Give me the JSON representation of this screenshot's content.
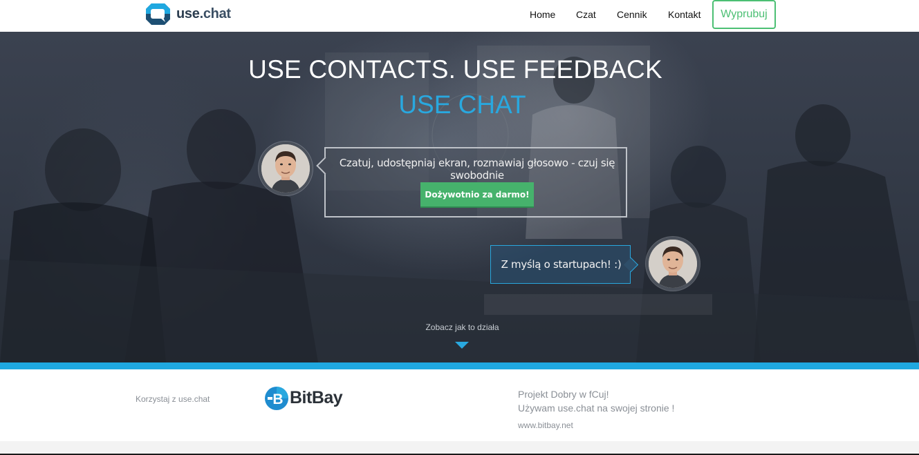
{
  "brand": {
    "logo_text_prefix": "use",
    "logo_text_suffix": ".chat",
    "accent_color": "#29a8df",
    "button_green": "#46b26c"
  },
  "nav": {
    "items": [
      {
        "label": "Home"
      },
      {
        "label": "Czat"
      },
      {
        "label": "Cennik"
      },
      {
        "label": "Kontakt"
      }
    ],
    "try_button": "Wyprubuj"
  },
  "hero": {
    "title_line_1": "USE CONTACTS. USE FEEDBACK",
    "title_line_2": "USE CHAT",
    "bubble_1_text": "Czatuj, udostępniaj ekran, rozmawiaj głosowo  - czuj się swobodnie",
    "cta_button": "Dożywotnio za darmo!",
    "bubble_2_text": "Z myślą o startupach! :)",
    "see_how": "Zobacz jak to działa"
  },
  "testimonial": {
    "uses_label": "Korzystaj z use.chat",
    "company_logo_text": "BitBay",
    "quote_line_1": "Projekt Dobry w fCuj!",
    "quote_line_2": "Używam use.chat na swojej stronie !",
    "url": "www.bitbay.net"
  }
}
